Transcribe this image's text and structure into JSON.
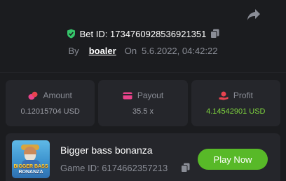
{
  "bet": {
    "label": "Bet ID:",
    "id": "173476092853692135",
    "id_suffix": "1",
    "by_label": "By",
    "user": "boaler",
    "on_label": "On",
    "date": "5.6.2022, 04:42:22"
  },
  "stats": {
    "amount": {
      "label": "Amount",
      "value": "0.12015704 USD"
    },
    "payout": {
      "label": "Payout",
      "value": "35.5 x"
    },
    "profit": {
      "label": "Profit",
      "value": "4.14542901 USD"
    }
  },
  "game": {
    "title": "Bigger bass bonanza",
    "id_label": "Game ID:",
    "id": "6174662357213",
    "thumb_text_top": "BIGGER BASS",
    "thumb_text_bottom": "BONANZA",
    "play_label": "Play Now"
  },
  "colors": {
    "background": "#1b1c1f",
    "card": "#25262b",
    "accent_green": "#58b928",
    "profit_green": "#7fd43f",
    "icon_red": "#e8434f",
    "icon_pink": "#e8438a",
    "shield_green": "#35c56a"
  },
  "icons": {
    "share": "share-arrow-icon",
    "verified": "shield-check-icon",
    "copy": "copy-icon",
    "amount": "coins-icon",
    "payout": "wallet-card-icon",
    "profit": "hand-coin-icon"
  }
}
